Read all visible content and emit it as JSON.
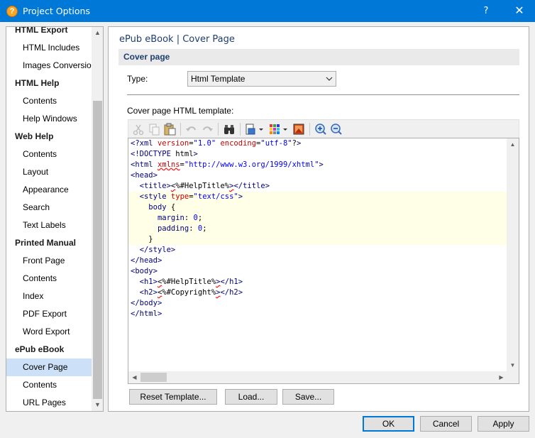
{
  "window": {
    "title": "Project Options",
    "help_label": "?",
    "close_label": "✕",
    "app_icon_glyph": "?"
  },
  "tree": {
    "items": [
      {
        "label": "HTML Export",
        "type": "group"
      },
      {
        "label": "HTML Includes",
        "type": "item"
      },
      {
        "label": "Images Conversion",
        "type": "item"
      },
      {
        "label": "HTML Help",
        "type": "group"
      },
      {
        "label": "Contents",
        "type": "item"
      },
      {
        "label": "Help Windows",
        "type": "item"
      },
      {
        "label": "Web Help",
        "type": "group"
      },
      {
        "label": "Contents",
        "type": "item"
      },
      {
        "label": "Layout",
        "type": "item"
      },
      {
        "label": "Appearance",
        "type": "item"
      },
      {
        "label": "Search",
        "type": "item"
      },
      {
        "label": "Text Labels",
        "type": "item"
      },
      {
        "label": "Printed Manual",
        "type": "group"
      },
      {
        "label": "Front Page",
        "type": "item"
      },
      {
        "label": "Contents",
        "type": "item"
      },
      {
        "label": "Index",
        "type": "item"
      },
      {
        "label": "PDF Export",
        "type": "item"
      },
      {
        "label": "Word Export",
        "type": "item"
      },
      {
        "label": "ePub eBook",
        "type": "group"
      },
      {
        "label": "Cover Page",
        "type": "item",
        "selected": true
      },
      {
        "label": "Contents",
        "type": "item"
      },
      {
        "label": "URL Pages",
        "type": "item"
      }
    ]
  },
  "panel": {
    "breadcrumb": "ePub eBook | Cover Page",
    "section_title": "Cover page",
    "type_label": "Type:",
    "type_value": "Html Template",
    "template_label": "Cover page HTML template:"
  },
  "toolbar": {
    "icons": [
      "cut-icon",
      "copy-icon",
      "paste-icon",
      "undo-icon",
      "redo-icon",
      "find-icon",
      "insert-field-icon",
      "color-palette-icon",
      "image-icon",
      "zoom-in-icon",
      "zoom-out-icon"
    ]
  },
  "editor": {
    "lines": [
      "<?xml version=\"1.0\" encoding=\"utf-8\"?>",
      "<!DOCTYPE html>",
      "<html xmlns=\"http://www.w3.org/1999/xhtml\">",
      "<head>",
      "  <title><%#HelpTitle%></title>",
      "  <style type=\"text/css\">",
      "    body {",
      "      margin: 0;",
      "      padding: 0;",
      "    }",
      "  </style>",
      "</head>",
      "<body>",
      "  <h1><%#HelpTitle%></h1>",
      "  <h2><%#Copyright%></h2>",
      "</body>",
      "</html>"
    ]
  },
  "actions": {
    "reset_template": "Reset Template...",
    "load": "Load...",
    "save": "Save...",
    "ok": "OK",
    "cancel": "Cancel",
    "apply": "Apply"
  },
  "colors": {
    "titlebar": "#0078d7",
    "selection": "#cce0f7",
    "accent_text": "#1e3e6e"
  }
}
